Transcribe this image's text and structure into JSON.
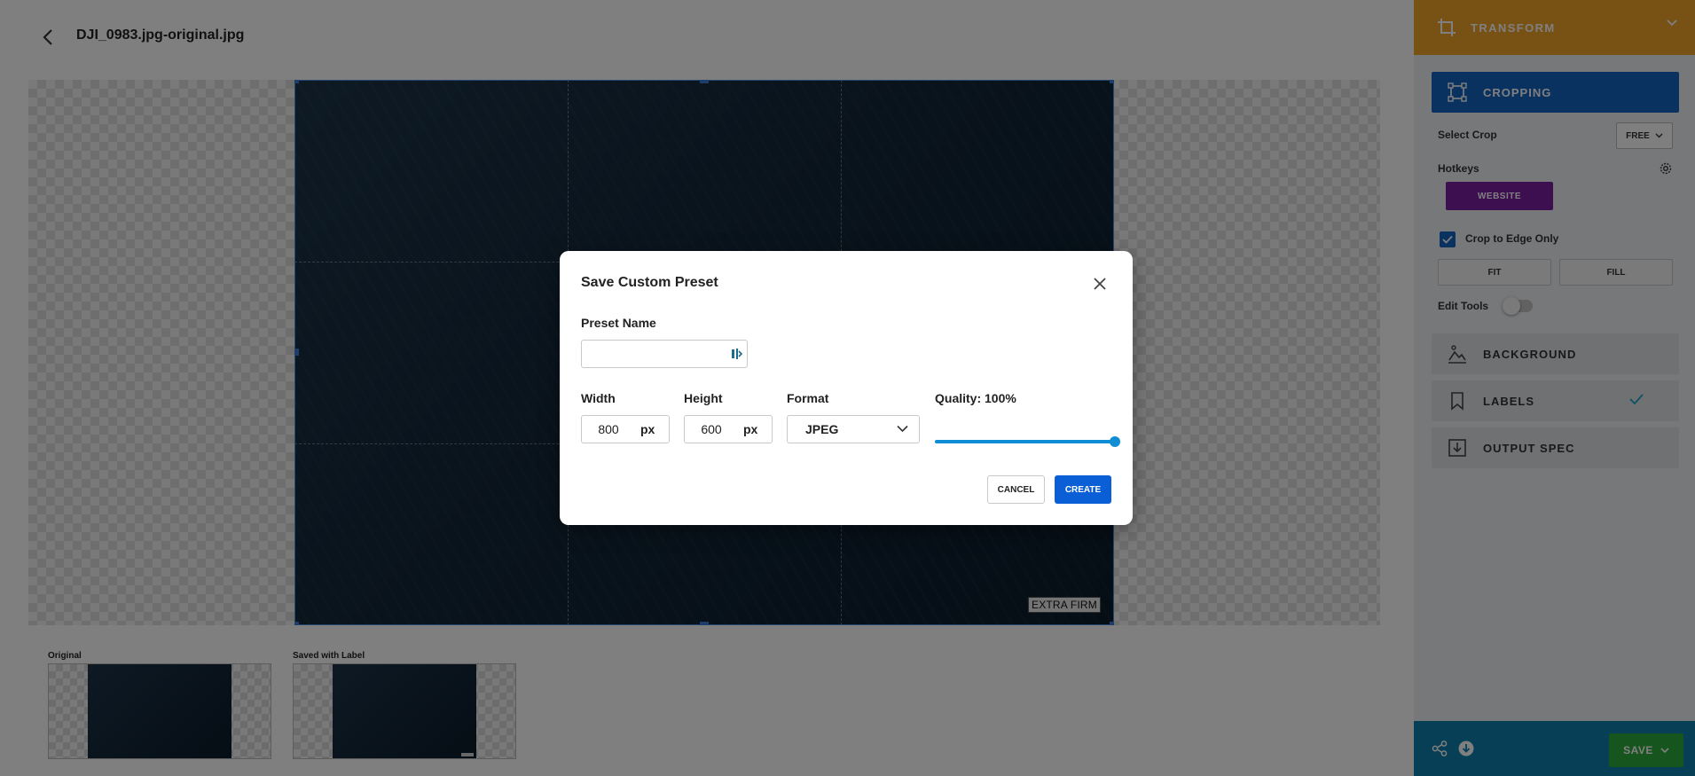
{
  "header": {
    "file_name": "DJI_0983.jpg-original.jpg",
    "back_icon": "chevron-left-icon"
  },
  "canvas": {
    "label_text": "EXTRA FIRM"
  },
  "thumbnails": [
    {
      "caption": "Original"
    },
    {
      "caption": "Saved with Label"
    }
  ],
  "panel": {
    "transform_title": "TRANSFORM",
    "cropping_title": "CROPPING",
    "select_crop_label": "Select Crop",
    "select_crop_value": "FREE",
    "hotkeys_label": "Hotkeys",
    "hotkey_button": "WEBSITE",
    "crop_edge_label": "Crop to Edge Only",
    "crop_edge_checked": true,
    "fit_label": "FIT",
    "fill_label": "FILL",
    "edit_tools_label": "Edit Tools",
    "edit_tools_on": false,
    "sections": [
      {
        "title": "BACKGROUND",
        "icon": "background-image-icon"
      },
      {
        "title": "LABELS",
        "icon": "bookmark-icon",
        "done": true
      },
      {
        "title": "OUTPUT SPEC",
        "icon": "download-icon"
      }
    ],
    "save_label": "SAVE"
  },
  "modal": {
    "title": "Save Custom Preset",
    "preset_name_label": "Preset Name",
    "preset_name_value": "",
    "width_label": "Width",
    "width_value": "800",
    "height_label": "Height",
    "height_value": "600",
    "unit": "px",
    "format_label": "Format",
    "format_value": "JPEG",
    "quality_label": "Quality: 100%",
    "quality_percent": 100,
    "cancel_label": "CANCEL",
    "create_label": "CREATE"
  },
  "colors": {
    "transform_header": "#f1a52b",
    "cropping_active": "#1565c0",
    "hotkey_purple": "#7b1fa2",
    "footer_blue": "#0e7fae",
    "save_green": "#2eaa3c",
    "create_blue": "#0b5fd6",
    "slider_blue": "#0f8ed6"
  }
}
